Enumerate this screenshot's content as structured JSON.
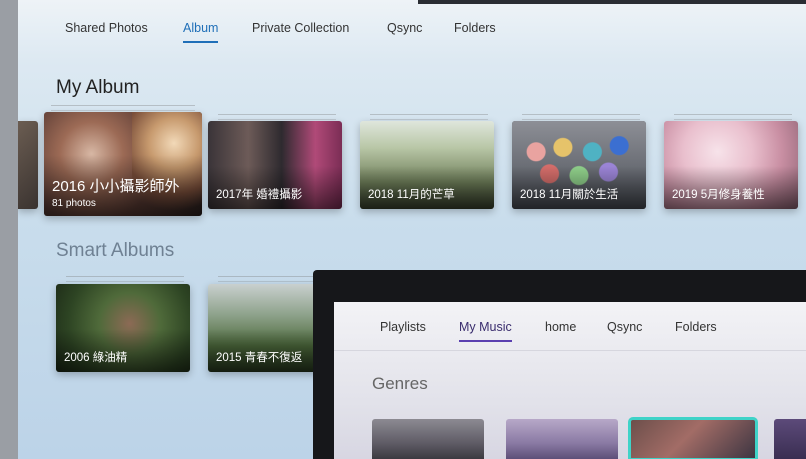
{
  "photos_app": {
    "tabs": [
      {
        "label": "Shared Photos",
        "active": false
      },
      {
        "label": "Album",
        "active": true
      },
      {
        "label": "Private Collection",
        "active": false
      },
      {
        "label": "Qsync",
        "active": false
      },
      {
        "label": "Folders",
        "active": false
      }
    ],
    "my_album": {
      "title": "My Album",
      "albums": [
        {
          "name": "2016 小小攝影師外",
          "count": "81 photos",
          "focused": true
        },
        {
          "name": "2017年 婚禮攝影",
          "count": "",
          "focused": false
        },
        {
          "name": "2018 11月的芒草",
          "count": "",
          "focused": false
        },
        {
          "name": "2018 11月關於生活",
          "count": "",
          "focused": false
        },
        {
          "name": "2019 5月修身養性",
          "count": "",
          "focused": false
        }
      ]
    },
    "smart_albums": {
      "title": "Smart Albums",
      "albums": [
        {
          "name": "2006 綠油精"
        },
        {
          "name": "2015 青春不復返"
        }
      ]
    },
    "accent_color": "#1f6fb8"
  },
  "music_app": {
    "tabs": [
      {
        "label": "Playlists",
        "active": false
      },
      {
        "label": "My Music",
        "active": true
      },
      {
        "label": "home",
        "active": false
      },
      {
        "label": "Qsync",
        "active": false
      },
      {
        "label": "Folders",
        "active": false
      }
    ],
    "genres_title": "Genres",
    "accent_color": "#5a3fb0",
    "focus_color": "#3fd3c8"
  }
}
